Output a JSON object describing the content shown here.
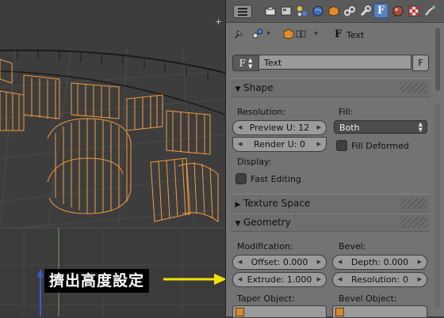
{
  "viewport": {
    "annotation": "擠出高度設定"
  },
  "header": {
    "icons": [
      "menu-icon",
      "render-icon",
      "render-layers-icon",
      "scene-icon",
      "world-icon",
      "object-icon",
      "constraints-icon",
      "modifiers-icon",
      "text-data-icon",
      "material-icon",
      "texture-icon",
      "physics-icon"
    ]
  },
  "breadcrumb": {
    "object_name": "",
    "data_name": "Text"
  },
  "datablock": {
    "type_glyph": "F",
    "name": "Text",
    "fake_user": "F"
  },
  "shape": {
    "title": "Shape",
    "resolution_label": "Resolution:",
    "preview_u": "Preview U: 12",
    "render_u": "Render U: 0",
    "fill_label": "Fill:",
    "fill_value": "Both",
    "fill_deformed": "Fill Deformed",
    "display_label": "Display:",
    "fast_editing": "Fast Editing"
  },
  "texture_space": {
    "title": "Texture Space"
  },
  "geometry": {
    "title": "Geometry",
    "modification_label": "Modification:",
    "offset": "Offset: 0.000",
    "extrude": "Extrude: 1.000",
    "bevel_label": "Bevel:",
    "depth": "Depth: 0.000",
    "resolution": "Resolution: 0",
    "taper_label": "Taper Object:",
    "bevel_object_label": "Bevel Object:"
  },
  "colors": {
    "accent": "#5680c2",
    "wire": "#f59a3c",
    "annotation_arrow": "#f2e200"
  }
}
